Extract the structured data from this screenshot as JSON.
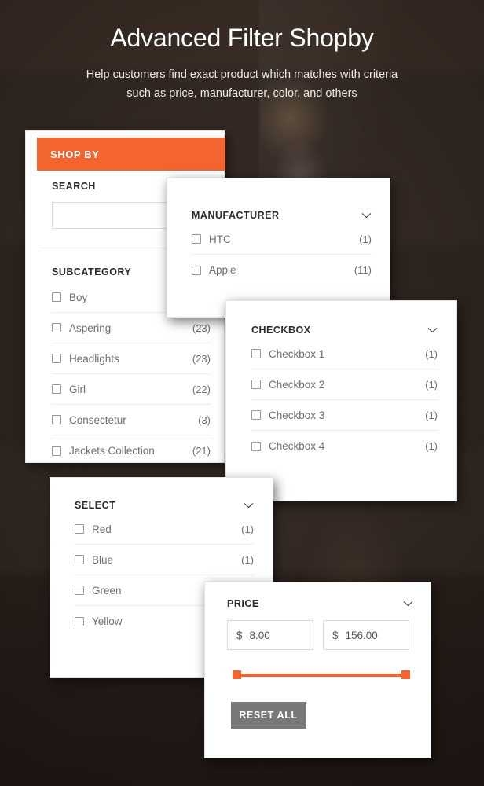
{
  "header": {
    "title": "Advanced Filter Shopby",
    "subtitle": "Help customers find exact product which matches with criteria such as price, manufacturer, color, and others"
  },
  "colors": {
    "accent": "#f4642f",
    "background": "#2e241f",
    "panel": "#ffffff",
    "reset_button": "#787878",
    "text_muted": "#6f6f6f"
  },
  "shopby_panel": {
    "header_label": "SHOP BY",
    "search": {
      "label": "SEARCH",
      "value": "",
      "placeholder": ""
    },
    "subcategory": {
      "title": "SUBCATEGORY",
      "items": [
        {
          "label": "Boy",
          "count": ""
        },
        {
          "label": "Aspering",
          "count": "(23)"
        },
        {
          "label": "Headlights",
          "count": "(23)"
        },
        {
          "label": "Girl",
          "count": "(22)"
        },
        {
          "label": "Consectetur",
          "count": "(3)"
        },
        {
          "label": "Jackets Collection",
          "count": "(21)"
        }
      ]
    }
  },
  "manufacturer_panel": {
    "title": "MANUFACTURER",
    "toggle_icon": "chevron-down-icon",
    "items": [
      {
        "label": "HTC",
        "count": "(1)"
      },
      {
        "label": "Apple",
        "count": "(11)"
      }
    ]
  },
  "checkbox_panel": {
    "title": "CHECKBOX",
    "toggle_icon": "chevron-down-icon",
    "items": [
      {
        "label": "Checkbox 1",
        "count": "(1)"
      },
      {
        "label": "Checkbox 2",
        "count": "(1)"
      },
      {
        "label": "Checkbox 3",
        "count": "(1)"
      },
      {
        "label": "Checkbox 4",
        "count": "(1)"
      }
    ]
  },
  "select_panel": {
    "title": "SELECT",
    "toggle_icon": "chevron-down-icon",
    "items": [
      {
        "label": "Red",
        "count": "(1)"
      },
      {
        "label": "Blue",
        "count": "(1)"
      },
      {
        "label": "Green",
        "count": ""
      },
      {
        "label": "Yellow",
        "count": ""
      }
    ]
  },
  "price_panel": {
    "title": "PRICE",
    "toggle_icon": "chevron-down-icon",
    "min": {
      "currency": "$",
      "value": "8.00"
    },
    "max": {
      "currency": "$",
      "value": "156.00"
    },
    "reset_label": "RESET ALL"
  }
}
